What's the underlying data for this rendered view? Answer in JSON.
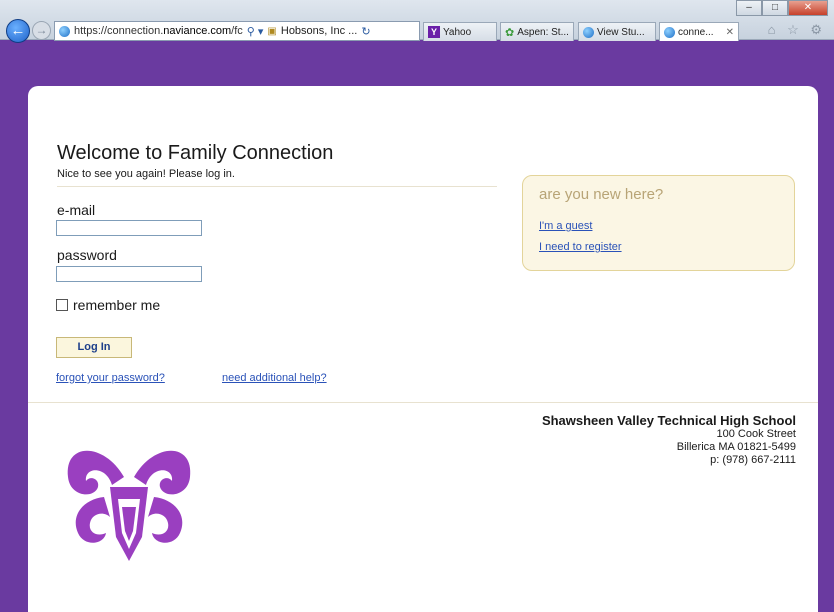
{
  "browser": {
    "back_icon": "back-arrow-icon",
    "forward_icon": "forward-arrow-icon",
    "address_url_prefix": "https://connection.",
    "address_url_domain": "naviance.com",
    "address_url_suffix": "/fc",
    "search_glyph": "⚲ ▾",
    "lock_glyph": "🔒",
    "site_identity": "Hobsons, Inc ...",
    "refresh_glyph": "↻",
    "tabs": [
      {
        "label": "Yahoo",
        "icon": "yahoo-icon"
      },
      {
        "label": "Aspen: St...",
        "icon": "aspen-icon"
      },
      {
        "label": "View Stu...",
        "icon": "ie-page-icon"
      },
      {
        "label": "conne...",
        "icon": "ie-page-icon",
        "active": true
      }
    ],
    "window_controls": [
      "–",
      "□",
      "✕"
    ],
    "toolbar_icons": "⌂ ☆ ⚙"
  },
  "login": {
    "heading": "Welcome to Family Connection",
    "subtitle": "Nice to see you again! Please log in.",
    "email_label": "e-mail",
    "email_value": "",
    "password_label": "password",
    "password_value": "",
    "remember_label": "remember me",
    "login_button": "Log In",
    "forgot_link": "forgot your password?",
    "help_link": "need additional help?"
  },
  "new_user": {
    "title": "are you new here?",
    "guest_link": "I'm a guest",
    "register_link": "I need to register"
  },
  "school": {
    "name": "Shawsheen Valley Technical High School",
    "street": "100 Cook Street",
    "city": "Billerica MA 01821-5499",
    "phone": "p: (978) 667-2111",
    "logo": "ram-logo"
  },
  "colors": {
    "page_background": "#6a3aa0",
    "accent_purple": "#9a3fc0",
    "link": "#2a52b8",
    "new_box_bg": "#fbf6e4"
  }
}
